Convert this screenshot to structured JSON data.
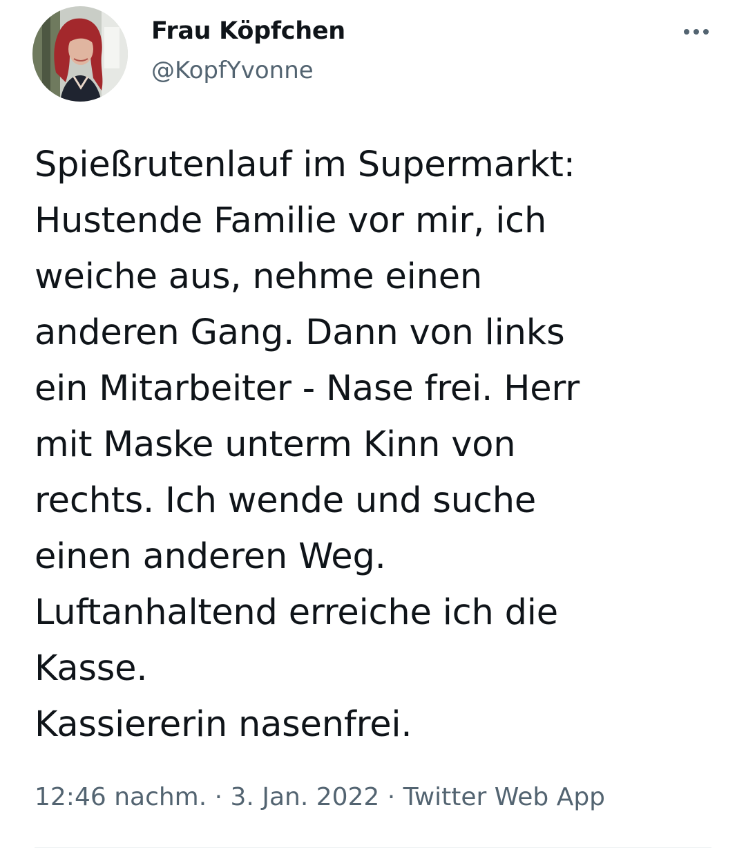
{
  "author": {
    "display_name": "Frau Köpfchen",
    "handle": "@KopfYvonne"
  },
  "tweet": {
    "text": "Spießrutenlauf im Supermarkt:\nHustende Familie vor mir, ich\nweiche aus, nehme einen\nanderen Gang. Dann von links\nein Mitarbeiter - Nase frei. Herr\nmit Maske unterm Kinn von\nrechts. Ich wende und suche\neinen anderen Weg.\nLuftanhaltend erreiche ich die\nKasse.\nKassiererin nasenfrei.",
    "time": "12:46 nachm.",
    "separator": " · ",
    "date": "3. Jan. 2022",
    "source": "Twitter Web App"
  },
  "icons": {
    "more": "more-horizontal-icon"
  },
  "colors": {
    "text": "#0f1419",
    "secondary": "#536471",
    "background": "#ffffff"
  }
}
